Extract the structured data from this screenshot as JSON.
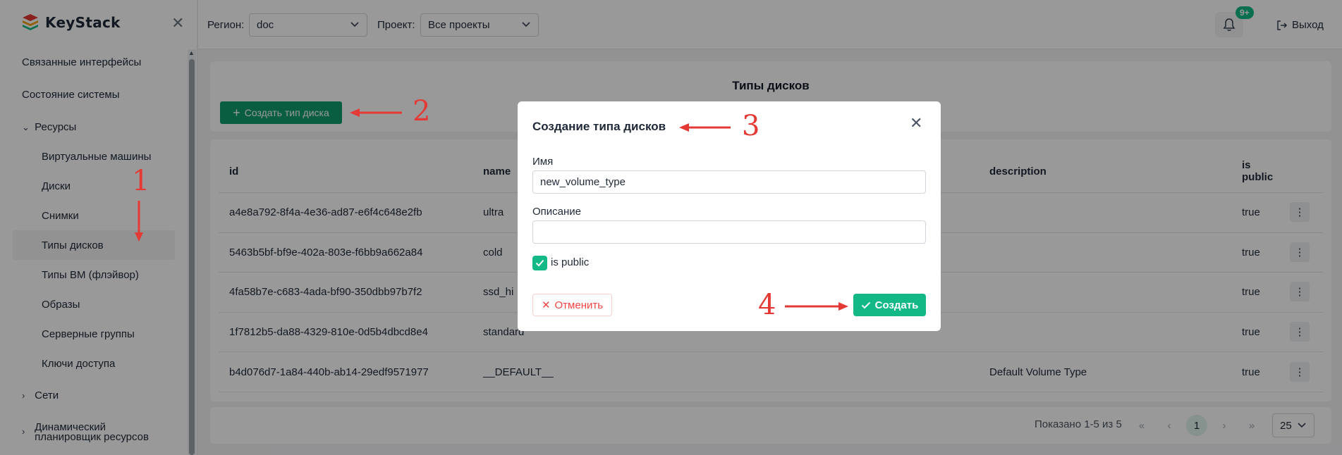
{
  "app": {
    "logo_text": "KeyStack"
  },
  "sidebar": {
    "items": [
      {
        "label": "Связанные интерфейсы"
      },
      {
        "label": "Состояние системы"
      },
      {
        "label": "Ресурсы"
      },
      {
        "label": "Виртуальные машины"
      },
      {
        "label": "Диски"
      },
      {
        "label": "Снимки"
      },
      {
        "label": "Типы дисков"
      },
      {
        "label": "Типы ВМ (флэйвор)"
      },
      {
        "label": "Образы"
      },
      {
        "label": "Серверные группы"
      },
      {
        "label": "Ключи доступа"
      },
      {
        "label": "Сети"
      },
      {
        "label": "Динамический"
      },
      {
        "label": "планировщик ресурсов"
      }
    ]
  },
  "topbar": {
    "region_label": "Регион:",
    "region_value": "doc",
    "project_label": "Проект:",
    "project_value": "Все проекты",
    "notifications_badge": "9+",
    "logout_label": "Выход"
  },
  "main": {
    "title": "Типы дисков",
    "create_button": "Создать тип диска",
    "table": {
      "headers": {
        "id": "id",
        "name": "name",
        "description": "description",
        "is_public_1": "is",
        "is_public_2": "public"
      },
      "rows": [
        {
          "id": "a4e8a792-8f4a-4e36-ad87-e6f4c648e2fb",
          "name": "ultra",
          "description": "",
          "is_public": "true"
        },
        {
          "id": "5463b5bf-bf9e-402a-803e-f6bb9a662a84",
          "name": "cold",
          "description": "",
          "is_public": "true"
        },
        {
          "id": "4fa58b7e-c683-4ada-bf90-350dbb97b7f2",
          "name": "ssd_hi",
          "description": "",
          "is_public": "true"
        },
        {
          "id": "1f7812b5-da88-4329-810e-0d5b4dbcd8e4",
          "name": "standard",
          "description": "",
          "is_public": "true"
        },
        {
          "id": "b4d076d7-1a84-440b-ab14-29edf9571977",
          "name": "__DEFAULT__",
          "description": "Default Volume Type",
          "is_public": "true"
        }
      ]
    },
    "pagination": {
      "summary": "Показано 1-5 из 5",
      "current_page": "1",
      "page_size": "25"
    }
  },
  "modal": {
    "title": "Создание типа дисков",
    "name_label": "Имя",
    "name_value": "new_volume_type",
    "description_label": "Описание",
    "description_value": "",
    "is_public_label": "is public",
    "cancel_label": "Отменить",
    "create_label": "Создать"
  },
  "annotations": {
    "n1": "1",
    "n2": "2",
    "n3": "3",
    "n4": "4",
    "color": "#e53935"
  },
  "colors": {
    "accent": "#12b886",
    "dark_accent": "#0f9d6e",
    "danger": "#ef4444"
  }
}
